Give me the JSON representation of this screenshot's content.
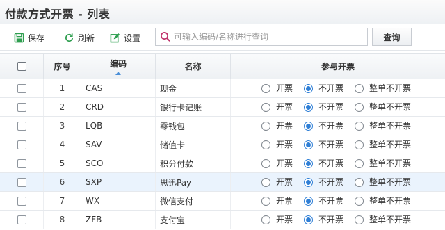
{
  "page": {
    "title": "付款方式开票 - 列表"
  },
  "toolbar": {
    "save_label": "保存",
    "refresh_label": "刷新",
    "settings_label": "设置",
    "search_placeholder": "可输入编码/名称进行查询",
    "search_value": "",
    "query_label": "查询"
  },
  "table": {
    "headers": {
      "index": "序号",
      "code": "编码",
      "name": "名称",
      "invoice": "参与开票"
    },
    "radio_labels": [
      "开票",
      "不开票",
      "整单不开票"
    ],
    "rows": [
      {
        "no": "1",
        "code": "CAS",
        "name": "现金",
        "selected": "不开票"
      },
      {
        "no": "2",
        "code": "CRD",
        "name": "银行卡记账",
        "selected": "不开票"
      },
      {
        "no": "3",
        "code": "LQB",
        "name": "零钱包",
        "selected": "不开票"
      },
      {
        "no": "4",
        "code": "SAV",
        "name": "储值卡",
        "selected": "不开票"
      },
      {
        "no": "5",
        "code": "SCO",
        "name": "积分付款",
        "selected": "不开票"
      },
      {
        "no": "6",
        "code": "SXP",
        "name": "思迅Pay",
        "selected": "不开票"
      },
      {
        "no": "7",
        "code": "WX",
        "name": "微信支付",
        "selected": "不开票"
      },
      {
        "no": "8",
        "code": "ZFB",
        "name": "支付宝",
        "selected": "不开票"
      }
    ],
    "highlighted_row_no": "6"
  },
  "colors": {
    "accent": "#2f7fd6",
    "save_icon": "#2e9e4f",
    "refresh_icon": "#2e9e4f",
    "settings_icon": "#2e9e4f",
    "search_icon": "#c0336b",
    "row_highlight": "#eaf3fd"
  },
  "icons": {
    "save": "save-icon",
    "refresh": "refresh-icon",
    "settings": "settings-icon",
    "search": "search-icon",
    "sort": "sort-ascending-icon"
  }
}
